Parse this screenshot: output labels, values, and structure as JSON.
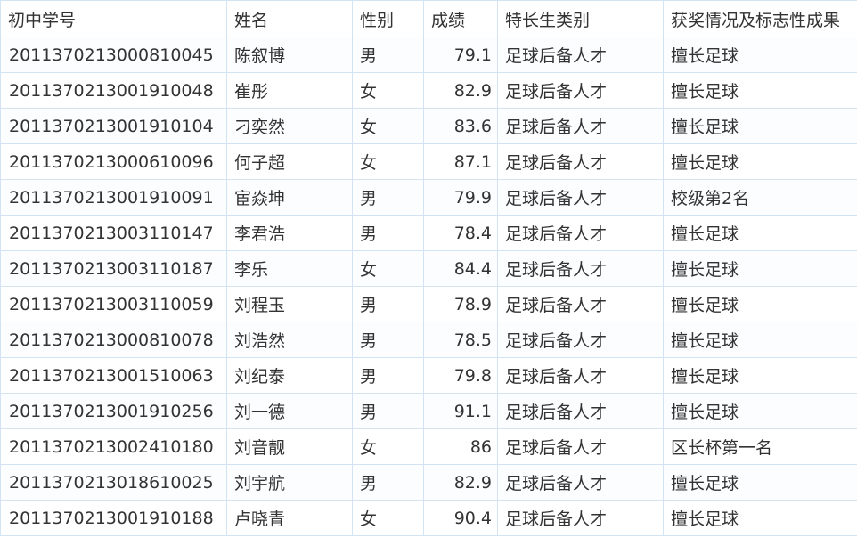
{
  "table": {
    "headers": [
      "初中学号",
      "姓名",
      "性别",
      "成绩",
      "特长生类别",
      "获奖情况及标志性成果"
    ],
    "rows": [
      [
        "2011370213000810045",
        "陈叙博",
        "男",
        "79.1",
        "足球后备人才",
        "擅长足球"
      ],
      [
        "2011370213001910048",
        "崔彤",
        "女",
        "82.9",
        "足球后备人才",
        "擅长足球"
      ],
      [
        "2011370213001910104",
        "刁奕然",
        "女",
        "83.6",
        "足球后备人才",
        "擅长足球"
      ],
      [
        "2011370213000610096",
        "何子超",
        "女",
        "87.1",
        "足球后备人才",
        "擅长足球"
      ],
      [
        "2011370213001910091",
        "宦焱坤",
        "男",
        "79.9",
        "足球后备人才",
        "校级第2名"
      ],
      [
        "2011370213003110147",
        "李君浩",
        "男",
        "78.4",
        "足球后备人才",
        "擅长足球"
      ],
      [
        "2011370213003110187",
        "李乐",
        "女",
        "84.4",
        "足球后备人才",
        "擅长足球"
      ],
      [
        "2011370213003110059",
        "刘程玉",
        "男",
        "78.9",
        "足球后备人才",
        "擅长足球"
      ],
      [
        "2011370213000810078",
        "刘浩然",
        "男",
        "78.5",
        "足球后备人才",
        "擅长足球"
      ],
      [
        "2011370213001510063",
        "刘纪泰",
        "男",
        "79.8",
        "足球后备人才",
        "擅长足球"
      ],
      [
        "2011370213001910256",
        "刘一德",
        "男",
        "91.1",
        "足球后备人才",
        "擅长足球"
      ],
      [
        "2011370213002410180",
        "刘音靓",
        "女",
        "86",
        "足球后备人才",
        "区长杯第一名"
      ],
      [
        "2011370213018610025",
        "刘宇航",
        "男",
        "82.9",
        "足球后备人才",
        "擅长足球"
      ],
      [
        "2011370213001910188",
        "卢晓青",
        "女",
        "90.4",
        "足球后备人才",
        "擅长足球"
      ]
    ]
  }
}
